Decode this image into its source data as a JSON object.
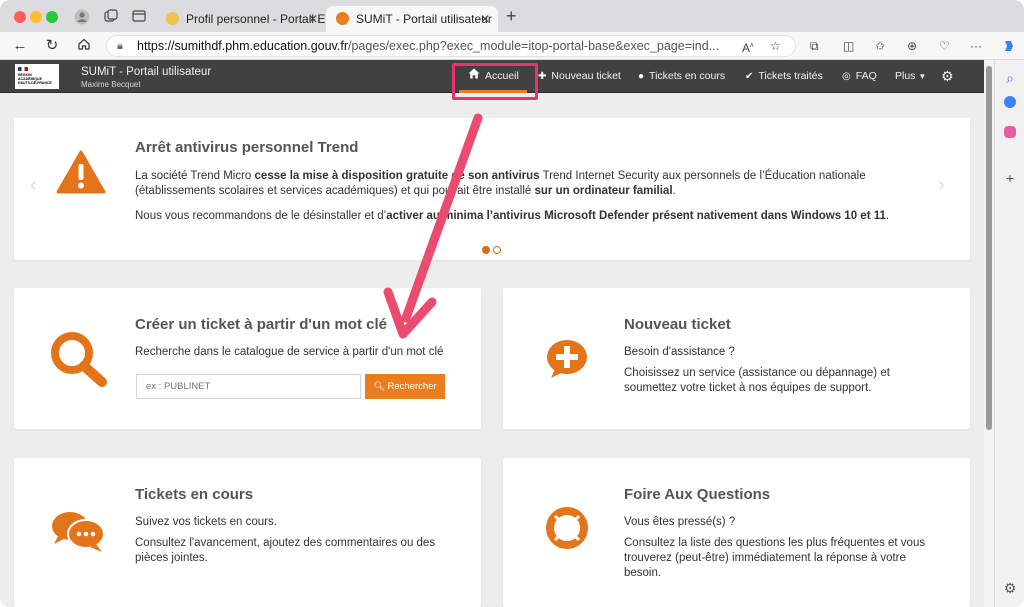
{
  "browser": {
    "tabs": [
      {
        "title": "Profil personnel - Portail E"
      },
      {
        "title": "SUMiT - Portail utilisateur"
      }
    ],
    "url_host": "https://sumithdf.phm.education.gouv.fr",
    "url_path": "/pages/exec.php?exec_module=itop-portal-base&exec_page=ind..."
  },
  "portal": {
    "logo_text": "RÉGION ACADÉMIQUE HAUTS-DE-FRANCE",
    "title": "SUMiT - Portail utilisateur",
    "user": "Maxime Becquet",
    "menu": [
      {
        "label": "Accueil",
        "icon": "home-icon"
      },
      {
        "label": "Nouveau ticket",
        "icon": "plus-bubble-icon"
      },
      {
        "label": "Tickets en cours",
        "icon": "chat-bubbles-icon"
      },
      {
        "label": "Tickets traités",
        "icon": "check-bubble-icon"
      },
      {
        "label": "FAQ",
        "icon": "lifebuoy-icon"
      },
      {
        "label": "Plus",
        "icon": "caret-down-icon"
      }
    ]
  },
  "announcement": {
    "title": "Arrêt antivirus personnel Trend",
    "p1_a": "La société Trend Micro ",
    "p1_b": "cesse la mise à disposition gratuite de son antivirus",
    "p1_c": " Trend Internet Security aux personnels de l’Éducation nationale (établissements scolaires et services académiques) et qui pouvait être installé ",
    "p1_d": "sur un ordinateur familial",
    "p1_e": ".",
    "p2_a": "Nous vous recommandons de le désinstaller et d’",
    "p2_b": "activer au minima l’antivirus Microsoft Defender présent nativement dans Windows 10 et 11",
    "p2_c": "."
  },
  "tiles": {
    "search": {
      "title": "Créer un ticket à partir d'un mot clé",
      "desc": "Recherche dans le catalogue de service à partir d'un mot clé",
      "placeholder": "ex : PUBLINET",
      "button": "Rechercher"
    },
    "new_ticket": {
      "title": "Nouveau ticket",
      "line1": "Besoin d'assistance ?",
      "line2": "Choisissez un service (assistance ou dépannage) et soumettez votre ticket à nos équipes de support."
    },
    "open_tickets": {
      "title": "Tickets en cours",
      "line1": "Suivez vos tickets en cours.",
      "line2": "Consultez l'avancement, ajoutez des commentaires ou des pièces jointes."
    },
    "faq": {
      "title": "Foire Aux Questions",
      "line1": "Vous êtes pressé(s) ?",
      "line2": "Consultez la liste des questions les plus fréquentes et vous trouverez (peut-être) immédiatement la réponse à votre besoin."
    }
  },
  "colors": {
    "accent": "#ea7d1d",
    "highlight": "#e8336b",
    "navbar": "#414141"
  }
}
